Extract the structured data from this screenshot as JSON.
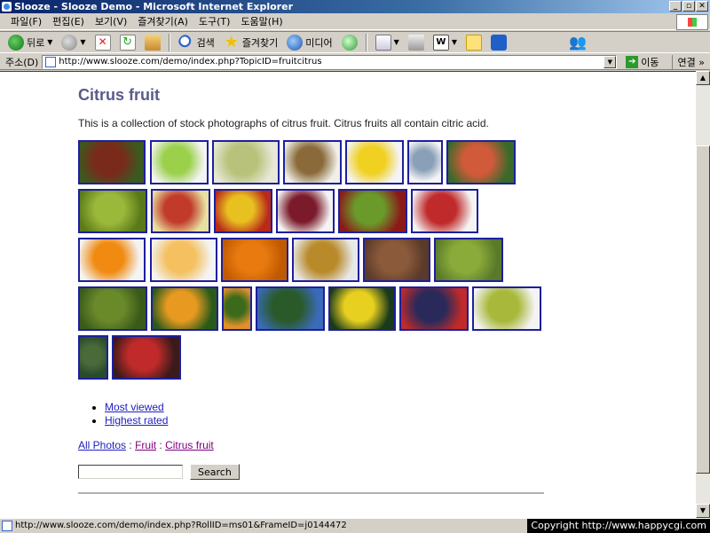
{
  "window": {
    "title": "Slooze - Slooze Demo - Microsoft Internet Explorer",
    "buttons": [
      "_",
      "▫",
      "✕"
    ]
  },
  "menubar": {
    "items": [
      "파일(F)",
      "편집(E)",
      "보기(V)",
      "즐겨찾기(A)",
      "도구(T)",
      "도움말(H)"
    ]
  },
  "toolbar": {
    "back_label": "뒤로",
    "search_label": "검색",
    "favorites_label": "즐겨찾기",
    "media_label": "미디어",
    "word_icon_text": "W",
    "icons": [
      "back-icon",
      "forward-icon",
      "stop-icon",
      "refresh-icon",
      "home-icon",
      "search-icon",
      "favorites-icon",
      "media-icon",
      "history-icon",
      "mail-icon",
      "print-icon",
      "word-icon",
      "note-icon",
      "blue-icon",
      "messenger-icon"
    ]
  },
  "address": {
    "label": "주소(D)",
    "url": "http://www.slooze.com/demo/index.php?TopicID=fruitcitrus",
    "go_label": "이동",
    "links_label": "연결 »"
  },
  "page": {
    "title": "Citrus fruit",
    "intro": "This is a collection of stock photographs of citrus fruit. Citrus fruits all contain citric acid.",
    "thumbnails": [
      {
        "name": "thumb-apples-tree",
        "colors": [
          "#7a2a1a",
          "#3a5a20"
        ]
      },
      {
        "name": "thumb-green-apples",
        "colors": [
          "#9ad04a",
          "#f4f4f4"
        ]
      },
      {
        "name": "thumb-grapes",
        "colors": [
          "#b8c27a",
          "#e8e8d8"
        ]
      },
      {
        "name": "thumb-kiwis",
        "colors": [
          "#8a6a3a",
          "#f0f0e8"
        ]
      },
      {
        "name": "thumb-lemons",
        "colors": [
          "#f0d020",
          "#f4f4f4"
        ]
      },
      {
        "name": "thumb-clipart",
        "colors": [
          "#8aa0b8",
          "#f4f4f4"
        ]
      },
      {
        "name": "thumb-peaches",
        "colors": [
          "#d05a3a",
          "#3a6a2a"
        ]
      },
      {
        "name": "thumb-lime-slice",
        "colors": [
          "#9ab83a",
          "#5a7a1a"
        ]
      },
      {
        "name": "thumb-pears-apples",
        "colors": [
          "#c23a2a",
          "#e8e0a0"
        ]
      },
      {
        "name": "thumb-lemon-apple",
        "colors": [
          "#e8c020",
          "#b82a1a"
        ]
      },
      {
        "name": "thumb-red-apples",
        "colors": [
          "#7a1a2a",
          "#f4f4f4"
        ]
      },
      {
        "name": "thumb-apple-mix",
        "colors": [
          "#6a9a2a",
          "#8a1a1a"
        ]
      },
      {
        "name": "thumb-red-apple",
        "colors": [
          "#c02a2a",
          "#f4f4f4"
        ]
      },
      {
        "name": "thumb-orange",
        "colors": [
          "#f08a10",
          "#f4f4f4"
        ]
      },
      {
        "name": "thumb-orange-slices",
        "colors": [
          "#f4c060",
          "#f4f4f4"
        ]
      },
      {
        "name": "thumb-oranges-pile",
        "colors": [
          "#e87a10",
          "#c05a00"
        ]
      },
      {
        "name": "thumb-pineapple",
        "colors": [
          "#b88a2a",
          "#e8e8e8"
        ]
      },
      {
        "name": "thumb-nuts",
        "colors": [
          "#8a5a3a",
          "#5a3a2a"
        ]
      },
      {
        "name": "thumb-green-grapes",
        "colors": [
          "#8aaa3a",
          "#5a7a2a"
        ]
      },
      {
        "name": "thumb-grape-crates",
        "colors": [
          "#6a8a2a",
          "#3a5a1a"
        ]
      },
      {
        "name": "thumb-orange-tree",
        "colors": [
          "#e89a20",
          "#2a5a1a"
        ]
      },
      {
        "name": "thumb-tree-small",
        "colors": [
          "#3a6a1a",
          "#e0902a"
        ]
      },
      {
        "name": "thumb-orange-grove",
        "colors": [
          "#2a5a2a",
          "#3a6ab8"
        ]
      },
      {
        "name": "thumb-lemon-tree",
        "colors": [
          "#e8d020",
          "#1a3a1a"
        ]
      },
      {
        "name": "thumb-dark-grapes",
        "colors": [
          "#2a2a5a",
          "#c02a2a"
        ]
      },
      {
        "name": "thumb-pear",
        "colors": [
          "#a8b83a",
          "#f4f4f4"
        ]
      },
      {
        "name": "thumb-grape-bunch",
        "colors": [
          "#4a6a3a",
          "#2a4a2a"
        ]
      },
      {
        "name": "thumb-market-fruit",
        "colors": [
          "#c02a2a",
          "#3a1a1a"
        ]
      }
    ],
    "sort_links": [
      "Most viewed",
      "Highest rated"
    ],
    "breadcrumb": [
      "All Photos",
      "Fruit",
      "Citrus fruit"
    ],
    "breadcrumb_separator": ":",
    "search_button": "Search"
  },
  "status": {
    "url": "http://www.slooze.com/demo/index.php?RollID=ms01&FrameID=j0144472",
    "copyright": "Copyright  http://www.happycgi.com"
  },
  "colors": {
    "title": "#5a5a8a",
    "thumb_border": "#1d1f9e",
    "link": "#2020c0",
    "visited_link": "#800080"
  }
}
